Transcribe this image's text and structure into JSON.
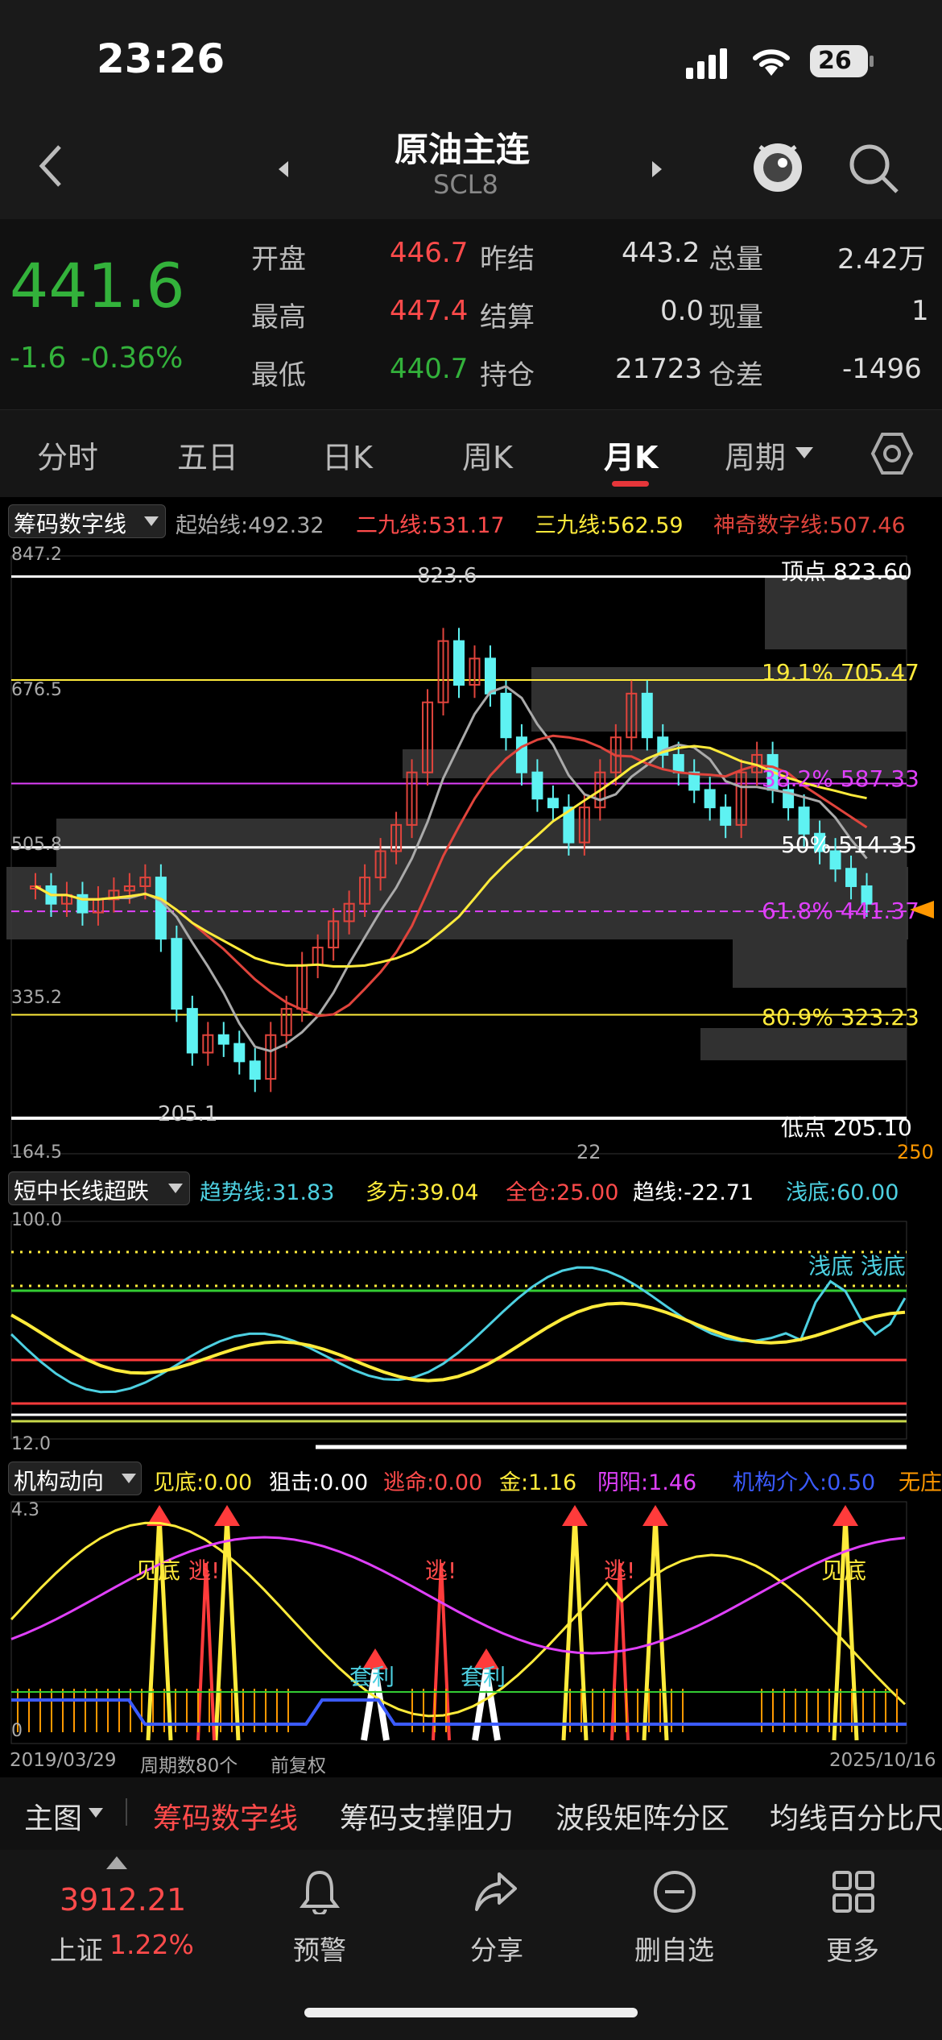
{
  "status": {
    "time": "23:26",
    "battery": "26"
  },
  "header": {
    "title": "原油主连",
    "code": "SCL8"
  },
  "quote": {
    "price": "441.6",
    "change": "-1.6",
    "change_pct": "-0.36%",
    "rows": [
      {
        "l1": "开盘",
        "v1": "446.7",
        "l2": "昨结",
        "v2": "443.2",
        "l3": "总量",
        "v3": "2.42万"
      },
      {
        "l1": "最高",
        "v1": "447.4",
        "l2": "结算",
        "v2": "0.0",
        "l3": "现量",
        "v3": "1"
      },
      {
        "l1": "最低",
        "v1": "440.7",
        "l2": "持仓",
        "v2": "21723",
        "l3": "仓差",
        "v3": "-1496"
      }
    ]
  },
  "tabs": [
    "分时",
    "五日",
    "日K",
    "周K",
    "月K",
    "周期"
  ],
  "main_chart": {
    "indicator": "筹码数字线",
    "legend": [
      {
        "text": "起始线:492.32",
        "color": "#aaaaaa"
      },
      {
        "text": "二九线:531.17",
        "color": "#ff4b4b"
      },
      {
        "text": "三九线:562.59",
        "color": "#ffeb3b"
      },
      {
        "text": "神奇数字线:507.46",
        "color": "#e0443c"
      }
    ],
    "axis": {
      "top": "847.2",
      "l1": "676.5",
      "l2": "505.8",
      "l3": "335.2",
      "bottom": "164.5"
    },
    "high_label": "823.6",
    "low_label": "205.1",
    "levels": [
      {
        "text": "顶点 823.60",
        "color": "#ffffff"
      },
      {
        "text": "19.1%  705.47",
        "color": "#ffeb3b"
      },
      {
        "text": "38.2%  587.33",
        "color": "#e040fb"
      },
      {
        "text": "50%  514.35",
        "color": "#ffffff"
      },
      {
        "text": "61.8%  441.37",
        "color": "#e040fb"
      },
      {
        "text": "80.9%  323.23",
        "color": "#ffeb3b"
      },
      {
        "text": "低点 205.10",
        "color": "#ffffff"
      }
    ],
    "tick_note": "22",
    "edge_note": "250"
  },
  "osc": {
    "indicator": "短中长线超跌",
    "legend": [
      {
        "text": "趋势线:31.83",
        "color": "#4dd0e1"
      },
      {
        "text": "多方:39.04",
        "color": "#ffeb3b"
      },
      {
        "text": "全仓:25.00",
        "color": "#ff4b4b"
      },
      {
        "text": "趋线:-22.71",
        "color": "#ffffff"
      },
      {
        "text": "浅底:60.00",
        "color": "#4dd0e1"
      }
    ],
    "top": "100.0",
    "bottom": "12.0",
    "label": "浅底 浅底"
  },
  "inst": {
    "indicator": "机构动向",
    "legend": [
      {
        "text": "见底:0.00",
        "color": "#ffeb3b"
      },
      {
        "text": "狙击:0.00",
        "color": "#ffffff"
      },
      {
        "text": "逃命:0.00",
        "color": "#ff4b4b"
      },
      {
        "text": "金:1.16",
        "color": "#ffeb3b"
      },
      {
        "text": "阴阳:1.46",
        "color": "#e040fb"
      },
      {
        "text": "机构介入:0.50",
        "color": "#3b5bff"
      },
      {
        "text": "无庄",
        "color": "#ff9800"
      }
    ],
    "top": "4.3",
    "zero": "0",
    "marks": {
      "bottom": "见底",
      "escape": "逃!",
      "profit": "套利"
    },
    "date_start": "2019/03/29",
    "period_count": "周期数80个",
    "adjust": "前复权",
    "date_end": "2025/10/16"
  },
  "indicator_tabs": {
    "main": "主图",
    "items": [
      "筹码数字线",
      "筹码支撑阻力",
      "波段矩阵分区",
      "均线百分比尺"
    ]
  },
  "bottom": {
    "index_value": "3912.21",
    "index_name": "上证",
    "index_pct": "1.22%",
    "items": [
      "预警",
      "分享",
      "删自选",
      "更多"
    ]
  }
}
